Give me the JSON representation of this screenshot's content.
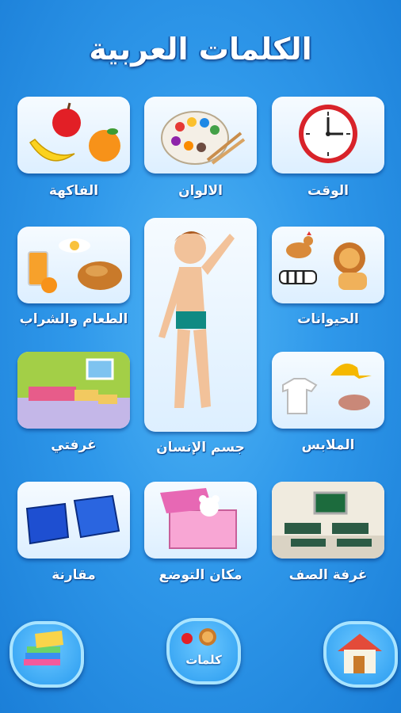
{
  "app": {
    "title": "الكلمات العربية"
  },
  "categories": [
    {
      "label": "الوقت",
      "icon": "clock-icon"
    },
    {
      "label": "الالوان",
      "icon": "paint-palette-icon"
    },
    {
      "label": "الفاكهة",
      "icon": "fruits-icon"
    },
    {
      "label": "الحيوانات",
      "icon": "animals-icon"
    },
    {
      "label": "جسم الإنسان",
      "icon": "human-body-icon"
    },
    {
      "label": "الطعام والشراب",
      "icon": "food-drink-icon"
    },
    {
      "label": "الملابس",
      "icon": "clothes-icon"
    },
    {
      "label": "غرفتي",
      "icon": "bedroom-icon"
    },
    {
      "label": "غرفة الصف",
      "icon": "classroom-icon"
    },
    {
      "label": "مكان التوضع",
      "icon": "toy-box-icon"
    },
    {
      "label": "مقارنة",
      "icon": "books-icon"
    }
  ],
  "bottom_nav": {
    "left": {
      "icon": "notebooks-icon"
    },
    "center": {
      "label": "كلمات",
      "icon": "words-icon"
    },
    "right": {
      "icon": "home-icon"
    }
  },
  "colors": {
    "background": "#2f98ea",
    "tile": "#eaf5ff",
    "text": "#ffffff"
  }
}
